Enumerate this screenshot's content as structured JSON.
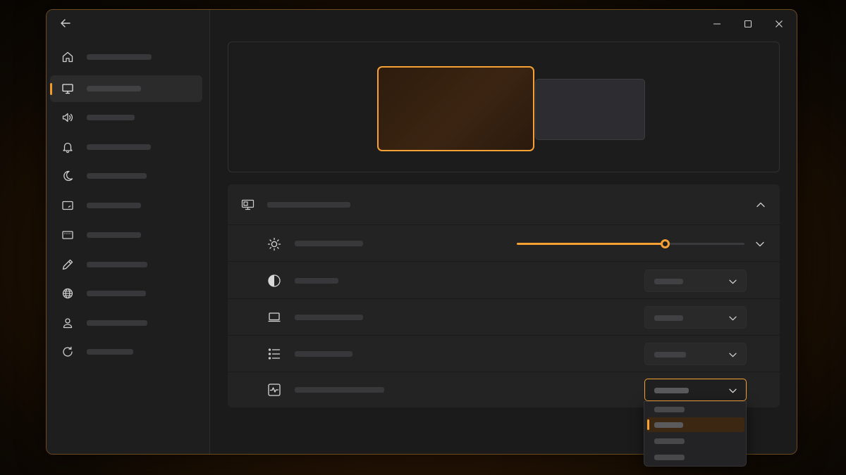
{
  "window": {
    "back_icon": "arrow-left-icon",
    "controls": [
      "minimize-icon",
      "maximize-icon",
      "close-icon"
    ]
  },
  "sidebar": {
    "active_index": 1,
    "items": [
      {
        "icon": "home-icon",
        "label": ""
      },
      {
        "icon": "monitor-icon",
        "label": ""
      },
      {
        "icon": "speaker-icon",
        "label": ""
      },
      {
        "icon": "bell-icon",
        "label": ""
      },
      {
        "icon": "moon-icon",
        "label": ""
      },
      {
        "icon": "tablet-icon",
        "label": ""
      },
      {
        "icon": "keyboard-icon",
        "label": ""
      },
      {
        "icon": "pen-icon",
        "label": ""
      },
      {
        "icon": "globe-icon",
        "label": ""
      },
      {
        "icon": "person-icon",
        "label": ""
      },
      {
        "icon": "refresh-icon",
        "label": ""
      }
    ]
  },
  "preview": {
    "monitors": [
      {
        "selected": true
      },
      {
        "selected": false
      }
    ]
  },
  "display_section": {
    "icon": "display-icon",
    "title": "",
    "expanded": true,
    "rows": [
      {
        "icon": "sun-icon",
        "label": "",
        "control": "slider",
        "value": 0.65
      },
      {
        "icon": "contrast-icon",
        "label": "",
        "control": "dropdown",
        "selected": ""
      },
      {
        "icon": "laptop-icon",
        "label": "",
        "control": "dropdown",
        "selected": ""
      },
      {
        "icon": "list-icon",
        "label": "",
        "control": "dropdown",
        "selected": ""
      },
      {
        "icon": "activity-icon",
        "label": "",
        "control": "dropdown",
        "selected": "",
        "open": true
      }
    ]
  },
  "dropdown_menu": {
    "selected_index": 1,
    "options": [
      "",
      "",
      "",
      ""
    ]
  },
  "colors": {
    "accent": "#f5a134",
    "window_bg": "#1b1b1c",
    "card_bg": "#232324",
    "placeholder_bar": "#38383a"
  }
}
